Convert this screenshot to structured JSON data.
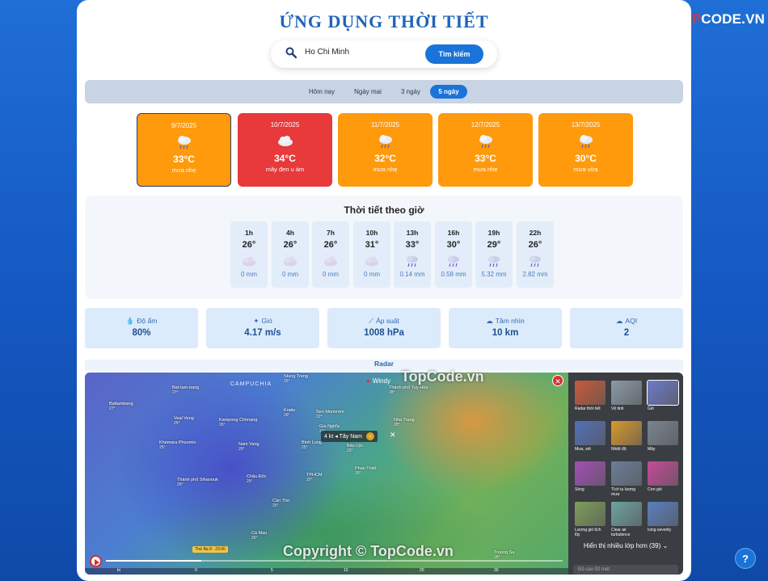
{
  "brand": {
    "part1": "TOP",
    "part2": "CODE.VN"
  },
  "app_title": "ỨNG DỤNG THỜI TIẾT",
  "search": {
    "value": "Ho Chi Minh",
    "button_label": "Tìm kiếm"
  },
  "tabs": [
    {
      "label": "Hôm nay",
      "active": false
    },
    {
      "label": "Ngày mai",
      "active": false
    },
    {
      "label": "3 ngày",
      "active": false
    },
    {
      "label": "5 ngày",
      "active": true
    }
  ],
  "daily": [
    {
      "date": "9/7/2025",
      "icon": "rain-cloud-icon",
      "temp": "33°C",
      "desc": "mưa nhẹ",
      "selected": true
    },
    {
      "date": "10/7/2025",
      "icon": "cloud-icon",
      "temp": "34°C",
      "desc": "mây đen u ám",
      "hot": true
    },
    {
      "date": "11/7/2025",
      "icon": "rain-cloud-icon",
      "temp": "32°C",
      "desc": "mưa nhẹ"
    },
    {
      "date": "12/7/2025",
      "icon": "rain-cloud-icon",
      "temp": "33°C",
      "desc": "mưa nhẹ"
    },
    {
      "date": "13/7/2025",
      "icon": "rain-cloud-icon",
      "temp": "30°C",
      "desc": "mưa vừa"
    }
  ],
  "hourly": {
    "title": "Thời tiết theo giờ",
    "items": [
      {
        "hour": "1h",
        "temp": "26°",
        "icon": "cloud-icon",
        "precip": "0 mm"
      },
      {
        "hour": "4h",
        "temp": "26°",
        "icon": "cloud-icon",
        "precip": "0 mm"
      },
      {
        "hour": "7h",
        "temp": "26°",
        "icon": "cloud-icon",
        "precip": "0 mm"
      },
      {
        "hour": "10h",
        "temp": "31°",
        "icon": "cloud-icon",
        "precip": "0 mm"
      },
      {
        "hour": "13h",
        "temp": "33°",
        "icon": "rain-cloud-icon",
        "precip": "0.14 mm"
      },
      {
        "hour": "16h",
        "temp": "30°",
        "icon": "rain-cloud-icon",
        "precip": "0.58 mm"
      },
      {
        "hour": "19h",
        "temp": "29°",
        "icon": "rain-cloud-icon",
        "precip": "5.32 mm"
      },
      {
        "hour": "22h",
        "temp": "26°",
        "icon": "rain-cloud-icon",
        "precip": "2.82 mm"
      }
    ]
  },
  "stats": [
    {
      "icon": "droplet-icon",
      "glyph": "💧",
      "label": "Độ ẩm",
      "value": "80%"
    },
    {
      "icon": "wind-icon",
      "glyph": "✦",
      "label": "Gió",
      "value": "4.17 m/s"
    },
    {
      "icon": "gauge-icon",
      "glyph": "⟋",
      "label": "Áp suất",
      "value": "1008 hPa"
    },
    {
      "icon": "eye-icon",
      "glyph": "☁",
      "label": "Tầm nhìn",
      "value": "10 km"
    },
    {
      "icon": "air-quality-icon",
      "glyph": "☁",
      "label": "AQI",
      "value": "2"
    }
  ],
  "radar": {
    "title": "Radar",
    "country": "CAMPUCHIA",
    "brand": "Windy",
    "wind_popup": {
      "speed": "4 kt",
      "direction": "Tây Nam"
    },
    "places": [
      {
        "name": "Battambang",
        "temp": "27°"
      },
      {
        "name": "Bat-tam-bang",
        "temp": "27°"
      },
      {
        "name": "Stung Treng",
        "temp": "25°"
      },
      {
        "name": "Kratie",
        "temp": "26°"
      },
      {
        "name": "Veal Veng",
        "temp": "25°"
      },
      {
        "name": "Kampong Chhnang",
        "temp": "26°"
      },
      {
        "name": "Khémara Phoumin",
        "temp": "25°"
      },
      {
        "name": "Nam Vang",
        "temp": "26°"
      },
      {
        "name": "Thành phố Sihanouk",
        "temp": "26°"
      },
      {
        "name": "Châu Đốc",
        "temp": "25°"
      },
      {
        "name": "Sen Monorom",
        "temp": "22°"
      },
      {
        "name": "Gia Nghĩa",
        "temp": "24°"
      },
      {
        "name": "Bình Long",
        "temp": "25°"
      },
      {
        "name": "Bảo Lộc",
        "temp": "23°"
      },
      {
        "name": "TPHCM",
        "temp": "25°"
      },
      {
        "name": "Phan Thiết",
        "temp": "26°"
      },
      {
        "name": "Nha Trang",
        "temp": "28°"
      },
      {
        "name": "Thành phố Tuy Hòa",
        "temp": "28°"
      },
      {
        "name": "Cần Thơ",
        "temp": "25°"
      },
      {
        "name": "Cà Mau",
        "temp": "26°"
      },
      {
        "name": "Truong Sa",
        "temp": "28°"
      }
    ],
    "timeline_tag": "Thứ Ba 8 - 23:00",
    "scale": [
      "kt",
      "0",
      "5",
      "10",
      "20",
      "30"
    ],
    "layers": [
      {
        "name": "Radar thời tiết",
        "color": "#c95a3a"
      },
      {
        "name": "Vệ tinh",
        "color": "#8b9aa8"
      },
      {
        "name": "Gió",
        "color": "#6d7bc9",
        "active": true
      },
      {
        "name": "Mưa, sét",
        "color": "#5270b8"
      },
      {
        "name": "Nhiệt độ",
        "color": "#d79a2c"
      },
      {
        "name": "Mây",
        "color": "#7a8590"
      },
      {
        "name": "Sóng",
        "color": "#a34fb5"
      },
      {
        "name": "Tích tụ lượng mưa",
        "color": "#6c7e9a"
      },
      {
        "name": "Cơn gió",
        "color": "#c64a9a"
      },
      {
        "name": "Lượng gió tích lũy",
        "color": "#7e9e5a"
      },
      {
        "name": "Clear air turbulence",
        "color": "#6da3a0"
      },
      {
        "name": "Icing severity",
        "color": "#5a7fbf"
      }
    ],
    "more_layers": "Hiển thị nhiều lớp hơn (39)",
    "layer_search_placeholder": "Độ cao 92 mét"
  },
  "watermarks": [
    "TopCode.vn",
    "Copyright © TopCode.vn"
  ],
  "colors": {
    "accent": "#1a73d9",
    "orange": "#ff9a0c",
    "red": "#e8393b"
  }
}
